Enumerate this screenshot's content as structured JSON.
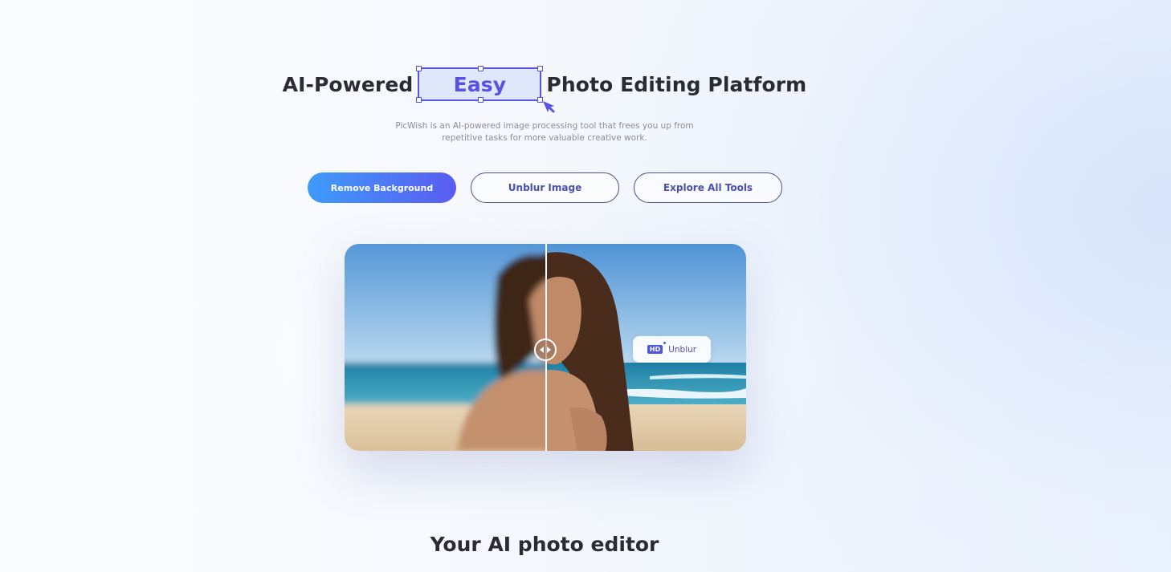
{
  "hero": {
    "headline_before": "AI-Powered",
    "headline_highlight": "Easy",
    "headline_after": "Photo Editing Platform",
    "subtitle_line1": "PicWish is an AI-powered image processing tool that frees you up from",
    "subtitle_line2": "repetitive tasks for more valuable creative work."
  },
  "buttons": {
    "remove_background": "Remove Background",
    "unblur_image": "Unblur Image",
    "explore_all_tools": "Explore All Tools"
  },
  "preview": {
    "badge_label": "HD",
    "chip_label": "Unblur",
    "handle_icon": "left-right-arrows-icon",
    "comparison": {
      "left": "blurred",
      "right": "sharp"
    }
  },
  "section": {
    "title": "Your AI photo editor"
  },
  "colors": {
    "accent": "#5a54e6",
    "button_gradient_start": "#3e9bfa",
    "button_gradient_end": "#5a5cf0",
    "heading_text": "#2a2b33"
  }
}
